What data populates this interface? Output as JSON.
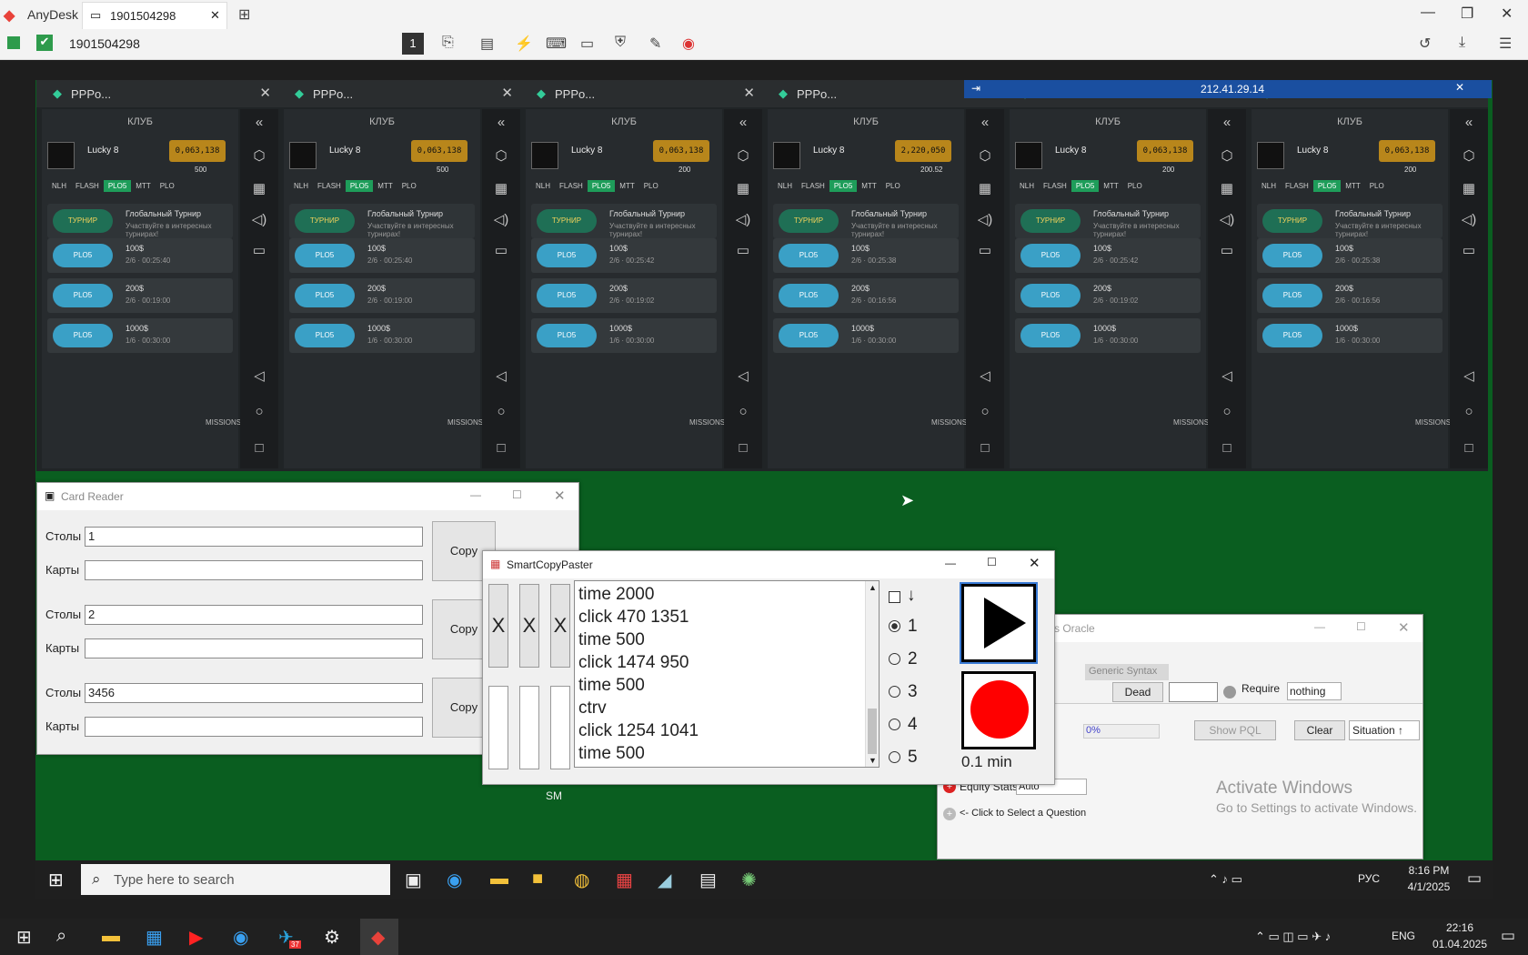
{
  "anydesk": {
    "brand": "AnyDesk",
    "tab_label": "1901504298",
    "address": "1901504298",
    "session_badge": "1"
  },
  "phones": [
    {
      "title": "PPPo...",
      "club": "КЛУБ",
      "name": "Lucky 8",
      "jackpot": "0,063,138",
      "bal": "500",
      "t1": "00:25:40",
      "t2": "00:19:00",
      "t3": "00:30:00"
    },
    {
      "title": "PPPo...",
      "club": "КЛУБ",
      "name": "Lucky 8",
      "jackpot": "0,063,138",
      "bal": "500",
      "t1": "00:25:40",
      "t2": "00:19:00",
      "t3": "00:30:00"
    },
    {
      "title": "PPPo...",
      "club": "КЛУБ",
      "name": "Lucky 8",
      "jackpot": "0,063,138",
      "bal": "200",
      "t1": "00:25:42",
      "t2": "00:19:02",
      "t3": "00:30:00"
    },
    {
      "title": "PPPo...",
      "club": "КЛУБ",
      "name": "Lucky 8",
      "jackpot": "2,220,050",
      "bal": "200.52",
      "t1": "00:25:38",
      "t2": "00:16:56",
      "t3": "00:30:00"
    },
    {
      "title": "PPPo...",
      "club": "КЛУБ",
      "name": "Lucky 8",
      "jackpot": "0,063,138",
      "bal": "200",
      "t1": "00:25:42",
      "t2": "00:19:02",
      "t3": "00:30:00"
    },
    {
      "title": "PPPo...",
      "club": "КЛУБ",
      "name": "Lucky 8",
      "jackpot": "0,063,138",
      "bal": "200",
      "t1": "00:25:38",
      "t2": "00:16:56",
      "t3": "00:30:00"
    }
  ],
  "phone_common": {
    "tabs": [
      "NLH",
      "FLASH",
      "PLO5",
      "MTT",
      "PLO"
    ],
    "tournament_title": "Глобальный Турнир",
    "tournament_sub": "Участвуйте в интересных турнирах!",
    "tournament_badge": "ТУРНИР ГЛОБАЛЬНЫЙ",
    "games": [
      "100$",
      "200$",
      "1000$"
    ],
    "seats": [
      "2/6",
      "2/6",
      "1/6"
    ],
    "pill": "PLO5",
    "missions": "MISSIONS"
  },
  "remote_title_ip": "212.41.29.14",
  "card_reader": {
    "title": "Card Reader",
    "rows": [
      {
        "tables_label": "Столы",
        "tables_value": "1",
        "cards_label": "Карты",
        "cards_value": "",
        "copy": "Copy"
      },
      {
        "tables_label": "Столы",
        "tables_value": "2",
        "cards_label": "Карты",
        "cards_value": "",
        "copy": "Copy"
      },
      {
        "tables_label": "Столы",
        "tables_value": "3456",
        "cards_label": "Карты",
        "cards_value": "",
        "copy": "Copy"
      }
    ]
  },
  "smart_copy_paster": {
    "title": "SmartCopyPaster",
    "script_lines": [
      "time 2000",
      "click 470 1351",
      "time 500",
      "click 1474 950",
      "time 500",
      "ctrv",
      "click 1254 1041",
      "time 500"
    ],
    "x_buttons": [
      "X",
      "X",
      "X"
    ],
    "down_arrow": "↓",
    "radios": [
      "1",
      "2",
      "3",
      "4",
      "5"
    ],
    "timer": "0.1 min",
    "sm_label": "SM"
  },
  "oracle": {
    "title_suffix": "s Oracle",
    "syntax": "Generic Syntax",
    "dead_button": "Dead",
    "require_label": "Require",
    "require_value": "nothing",
    "percent": "0%",
    "show_pql": "Show PQL",
    "clear": "Clear",
    "situation": "Situation ↑",
    "equity_label": "Equity Stats",
    "equity_value": "Auto",
    "question_hint": "<- Click to Select a Question",
    "watermark_1": "Activate Windows",
    "watermark_2": "Go to Settings to activate Windows."
  },
  "remote_taskbar": {
    "search_placeholder": "Type here to search",
    "lang": "РУС",
    "time": "8:16 PM",
    "date": "4/1/2025"
  },
  "local_taskbar": {
    "lang": "ENG",
    "time": "22:16",
    "date": "01.04.2025",
    "telegram_badge": "37"
  }
}
